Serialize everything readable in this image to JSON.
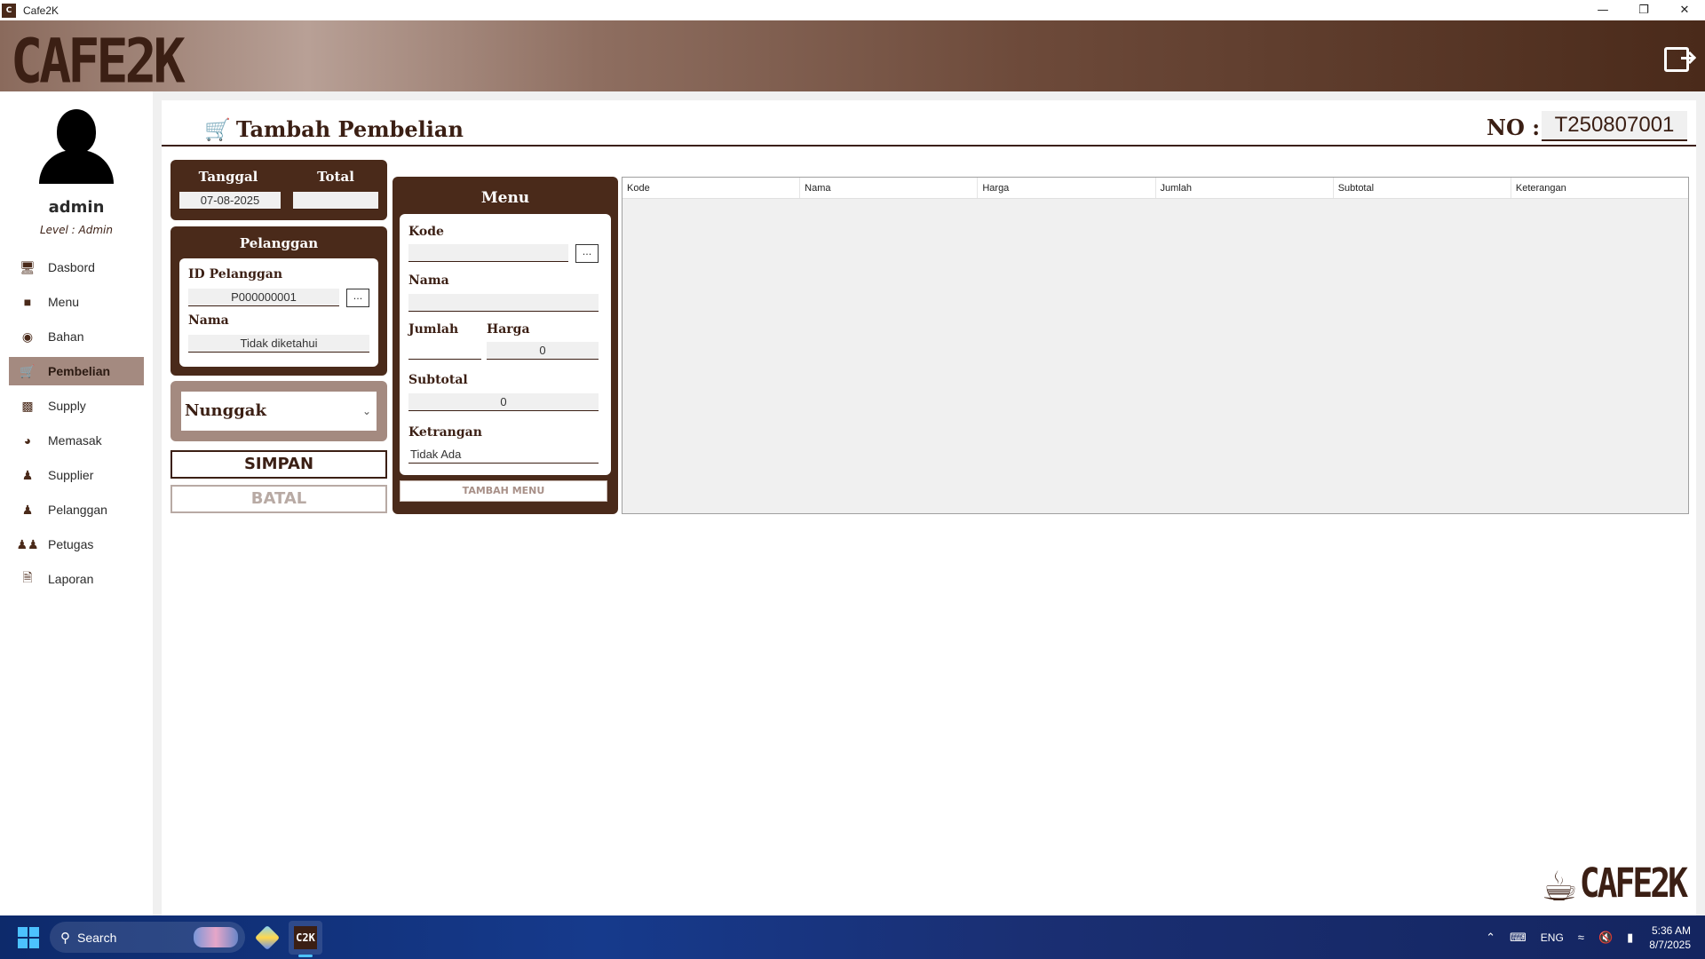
{
  "window": {
    "title": "Cafe2K",
    "app_icon": "Cafe2K",
    "controls": [
      "minimize-icon",
      "restore-icon",
      "close-icon"
    ]
  },
  "header": {
    "logo": "CAFE2K",
    "logout_icon": "logout-icon"
  },
  "user": {
    "name": "admin",
    "level": "Level : Admin"
  },
  "sidebar": {
    "items": [
      {
        "label": "Dasbord",
        "icon": "monitor-icon"
      },
      {
        "label": "Menu",
        "icon": "menu-book-icon"
      },
      {
        "label": "Bahan",
        "icon": "ingredients-icon"
      },
      {
        "label": "Pembelian",
        "icon": "cart-icon",
        "active": true
      },
      {
        "label": "Supply",
        "icon": "box-icon"
      },
      {
        "label": "Memasak",
        "icon": "cooking-pot-icon"
      },
      {
        "label": "Supplier",
        "icon": "supplier-icon"
      },
      {
        "label": "Pelanggan",
        "icon": "user-icon"
      },
      {
        "label": "Petugas",
        "icon": "users-icon"
      },
      {
        "label": "Laporan",
        "icon": "report-icon"
      }
    ]
  },
  "page": {
    "title": "Tambah Pembelian",
    "no_label": "NO :",
    "no_value": "T250807001"
  },
  "summary": {
    "tanggal_label": "Tanggal",
    "tanggal_value": "07-08-2025",
    "total_label": "Total",
    "total_value": ""
  },
  "pelanggan": {
    "title": "Pelanggan",
    "id_label": "ID Pelanggan",
    "id_value": "P000000001",
    "browse": "...",
    "nama_label": "Nama",
    "nama_value": "Tidak diketahui"
  },
  "status": {
    "selected": "Nunggak"
  },
  "actions": {
    "simpan": "SIMPAN",
    "batal": "BATAL"
  },
  "menu_panel": {
    "title": "Menu",
    "kode_label": "Kode",
    "kode_value": "",
    "browse": "...",
    "nama_label": "Nama",
    "nama_value": "",
    "jumlah_label": "Jumlah",
    "jumlah_value": "",
    "harga_label": "Harga",
    "harga_value": "0",
    "subtotal_label": "Subtotal",
    "subtotal_value": "0",
    "keterangan_label": "Ketrangan",
    "keterangan_value": "Tidak Ada",
    "add_button": "TAMBAH MENU"
  },
  "table": {
    "columns": [
      "Kode",
      "Nama",
      "Harga",
      "Jumlah",
      "Subtotal",
      "Keterangan"
    ],
    "rows": []
  },
  "brand_footer": "CAFE2K",
  "taskbar": {
    "search_placeholder": "Search",
    "tray": {
      "language": "ENG",
      "time": "5:36 AM",
      "date": "8/7/2025"
    }
  },
  "colors": {
    "brand_dark": "#4a2a1a",
    "brand_light": "#a48a80",
    "accent": "#3b1f14"
  }
}
